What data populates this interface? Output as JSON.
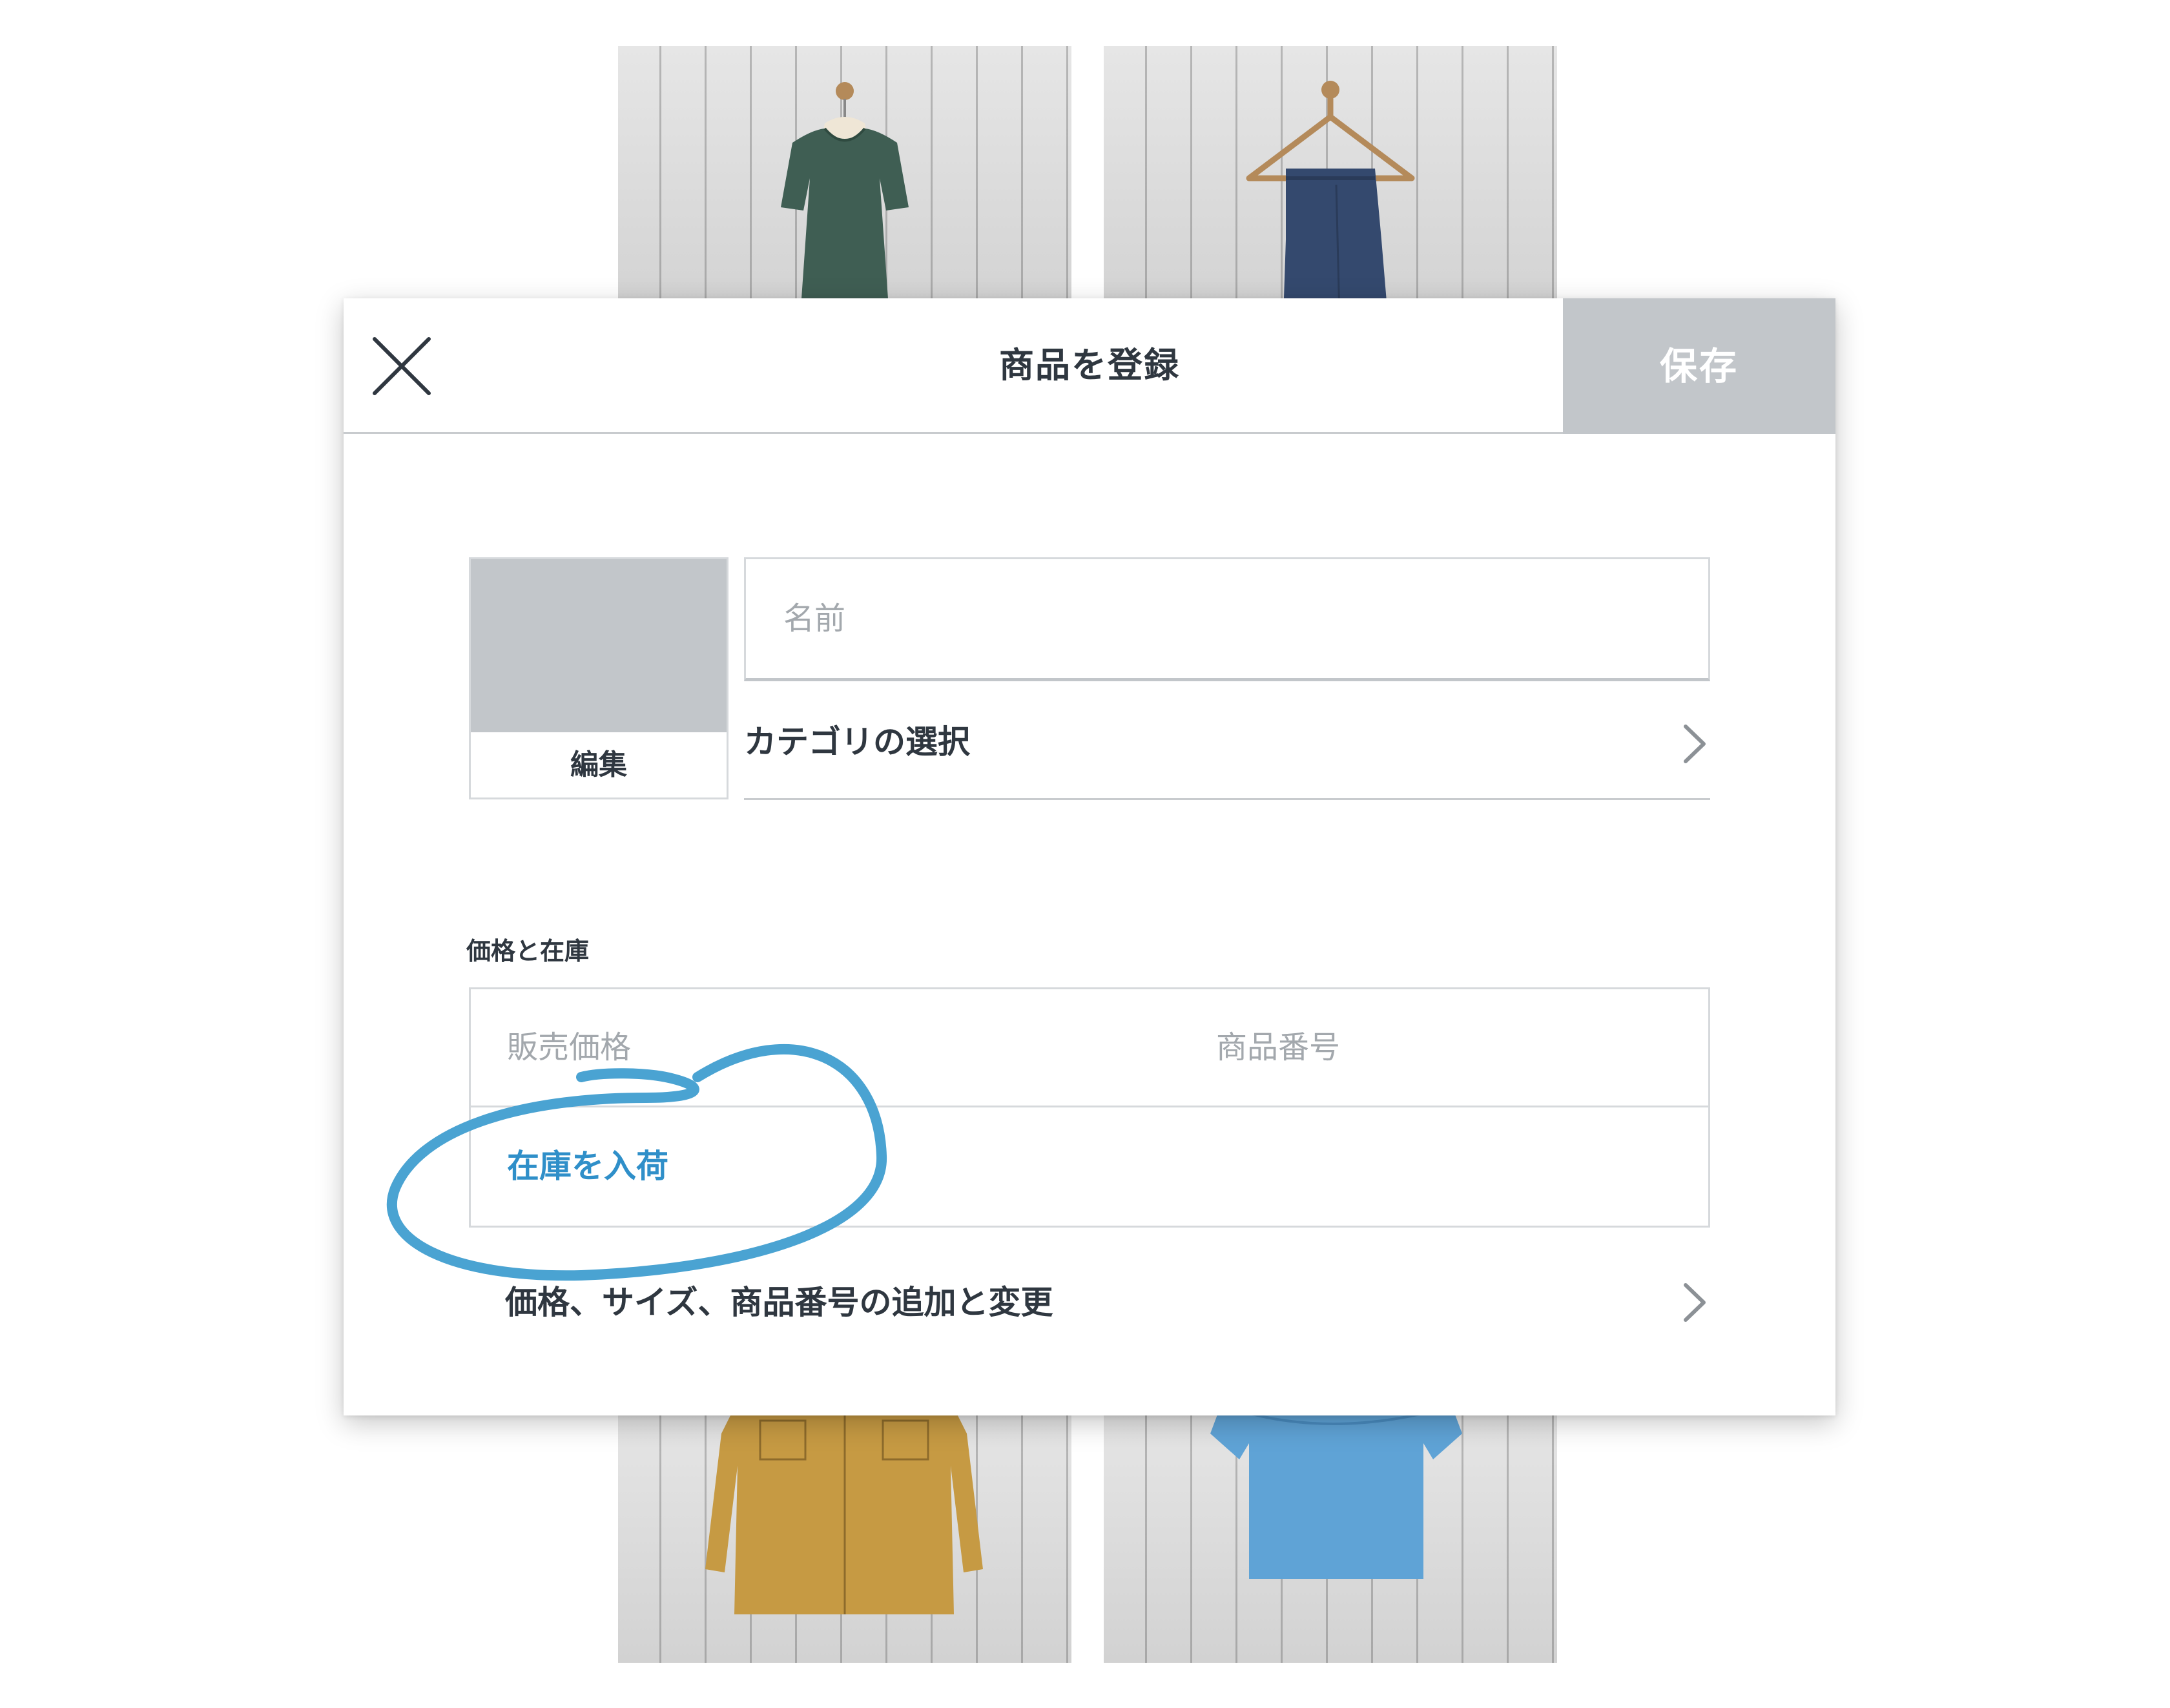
{
  "background": {
    "products": [
      "dress-photo",
      "jeans-photo",
      "shirt-photo",
      "tee-photo"
    ]
  },
  "modal": {
    "title": "商品を登録",
    "save_label": "保存",
    "close_icon": "close-icon",
    "image": {
      "edit_label": "編集"
    },
    "name": {
      "placeholder": "名前"
    },
    "category": {
      "label": "カテゴリの選択",
      "icon": "chevron-right-icon"
    },
    "section_label": "価格と在庫",
    "price": {
      "placeholder": "販売価格"
    },
    "sku": {
      "placeholder": "商品番号"
    },
    "restock_label": "在庫を入荷",
    "variants": {
      "label": "価格、サイズ、商品番号の追加と変更",
      "icon": "chevron-right-icon"
    }
  },
  "colors": {
    "accent": "#2f8fc9",
    "annotation": "#4aa3d2",
    "save_button_bg": "#c2c6ca",
    "text_dark": "#2f3740",
    "placeholder": "#a3a8ad"
  }
}
